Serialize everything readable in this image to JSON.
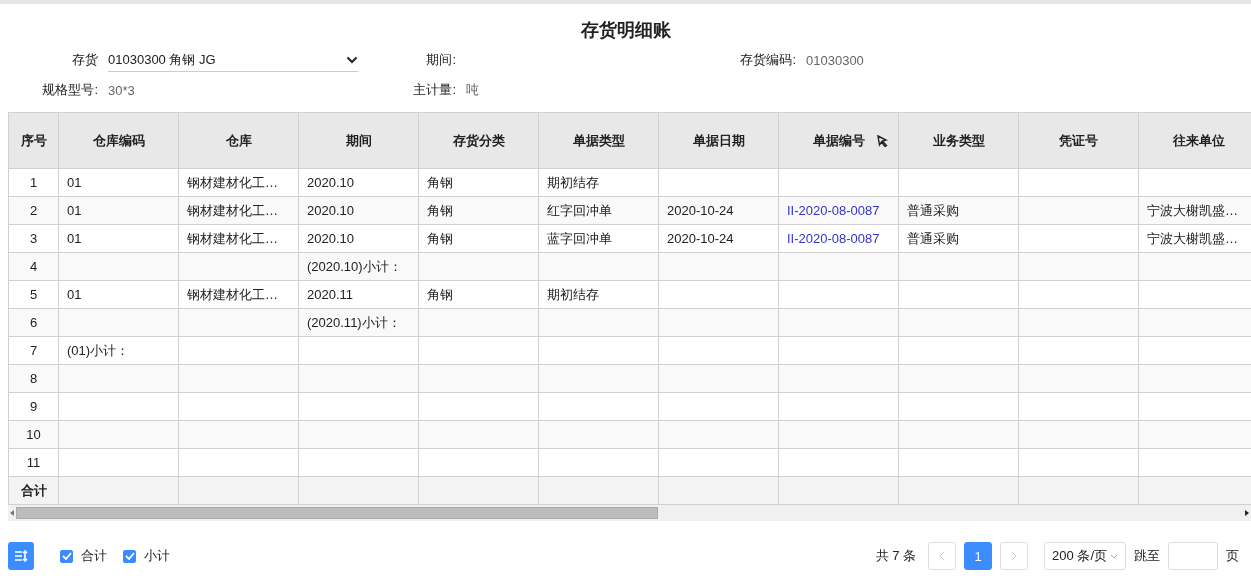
{
  "title": "存货明细账",
  "filters": [
    {
      "label": "存货",
      "kind": "select",
      "value": "01030300 角钢 JG"
    },
    {
      "label": "期间:",
      "kind": "text"
    },
    {
      "label": "存货编码:",
      "kind": "text",
      "value": "01030300"
    },
    {
      "label": "规格型号:",
      "kind": "text",
      "value": "30*3"
    },
    {
      "label": "主计量:",
      "kind": "text",
      "value": "吨"
    }
  ],
  "table": {
    "columns": [
      {
        "label": "序号",
        "kind": "index",
        "sortable": false
      },
      {
        "label": "仓库编码",
        "kind": "text",
        "sortable": false
      },
      {
        "label": "仓库",
        "kind": "text",
        "sortable": false
      },
      {
        "label": "期间",
        "kind": "text",
        "sortable": false
      },
      {
        "label": "存货分类",
        "kind": "text",
        "sortable": false
      },
      {
        "label": "单据类型",
        "kind": "text",
        "sortable": false
      },
      {
        "label": "单据日期",
        "kind": "text",
        "sortable": false
      },
      {
        "label": "单据编号",
        "kind": "link",
        "sortable": true
      },
      {
        "label": "业务类型",
        "kind": "text",
        "sortable": false
      },
      {
        "label": "凭证号",
        "kind": "text",
        "sortable": false
      },
      {
        "label": "往来单位",
        "kind": "text",
        "sortable": false
      }
    ],
    "rows": [
      {
        "cells": [
          "1",
          "01",
          "钢材建材化工…",
          "2020.10",
          "角钢",
          "期初结存",
          null,
          null,
          null,
          null,
          null
        ]
      },
      {
        "cells": [
          "2",
          "01",
          "钢材建材化工…",
          "2020.10",
          "角钢",
          "红字回冲单",
          "2020-10-24",
          "II-2020-08-0087",
          "普通采购",
          null,
          "宁波大榭凯盛…"
        ]
      },
      {
        "cells": [
          "3",
          "01",
          "钢材建材化工…",
          "2020.10",
          "角钢",
          "蓝字回冲单",
          "2020-10-24",
          "II-2020-08-0087",
          "普通采购",
          null,
          "宁波大榭凯盛…"
        ]
      },
      {
        "cells": [
          "4",
          null,
          null,
          "(2020.10)小计：",
          null,
          null,
          null,
          null,
          null,
          null,
          null
        ]
      },
      {
        "cells": [
          "5",
          "01",
          "钢材建材化工…",
          "2020.11",
          "角钢",
          "期初结存",
          null,
          null,
          null,
          null,
          null
        ]
      },
      {
        "cells": [
          "6",
          null,
          null,
          "(2020.11)小计：",
          null,
          null,
          null,
          null,
          null,
          null,
          null
        ]
      },
      {
        "cells": [
          "7",
          "(01)小计：",
          null,
          null,
          null,
          null,
          null,
          null,
          null,
          null,
          null
        ]
      },
      {
        "cells": [
          "8",
          null,
          null,
          null,
          null,
          null,
          null,
          null,
          null,
          null,
          null
        ]
      },
      {
        "cells": [
          "9",
          null,
          null,
          null,
          null,
          null,
          null,
          null,
          null,
          null,
          null
        ]
      },
      {
        "cells": [
          "10",
          null,
          null,
          null,
          null,
          null,
          null,
          null,
          null,
          null,
          null
        ]
      },
      {
        "cells": [
          "11",
          null,
          null,
          null,
          null,
          null,
          null,
          null,
          null,
          null,
          null
        ]
      }
    ],
    "total_label": "合计"
  },
  "options": [
    {
      "label": "合计",
      "checked": true
    },
    {
      "label": "小计",
      "checked": true
    }
  ],
  "pagination": {
    "total": "共 7 条",
    "pages": [
      {
        "label": "1",
        "selected": true
      }
    ],
    "page_size": "200 条/页",
    "jump_label": "跳至",
    "page_unit": "页"
  }
}
